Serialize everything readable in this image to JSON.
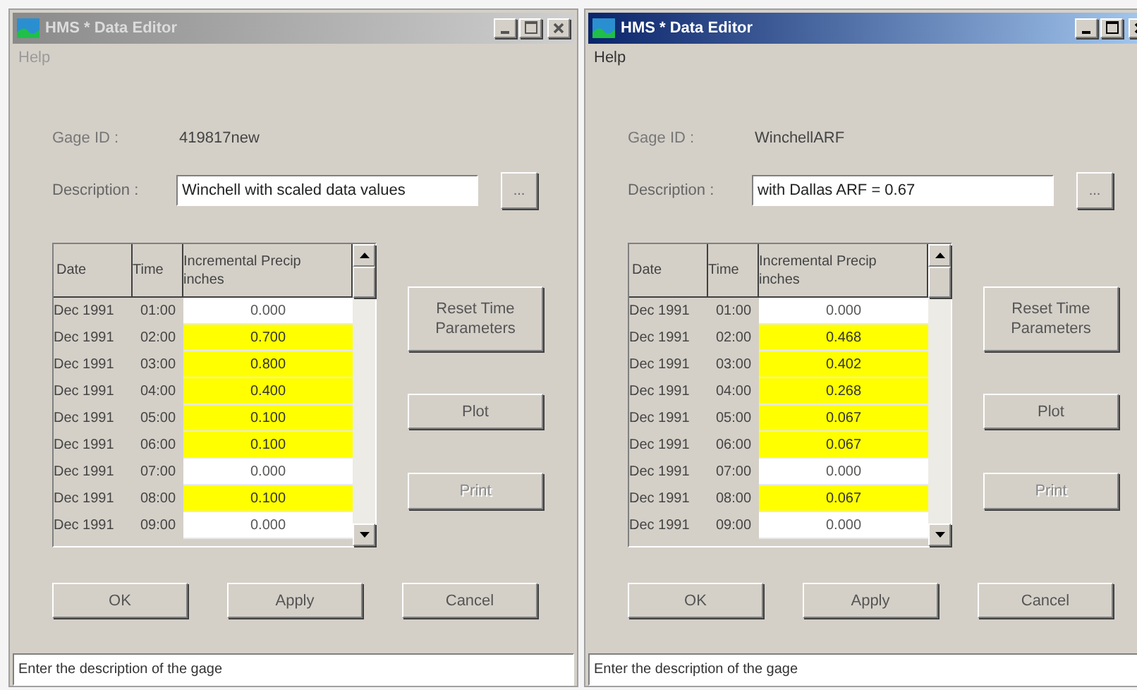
{
  "windows": [
    {
      "title": "HMS * Data Editor",
      "active": false,
      "menu": [
        "Help"
      ],
      "gage_id_label": "Gage ID :",
      "gage_id": "419817new",
      "description_label": "Description :",
      "description": "Winchell with scaled data values",
      "browse_button": "...",
      "table": {
        "columns": [
          {
            "label": "Date"
          },
          {
            "label": "Time"
          },
          {
            "label": "Incremental Precip",
            "unit": "inches"
          }
        ],
        "rows": [
          {
            "date": "Dec 1991",
            "time": "01:00",
            "value": "0.000",
            "modified": false
          },
          {
            "date": "Dec 1991",
            "time": "02:00",
            "value": "0.700",
            "modified": true
          },
          {
            "date": "Dec 1991",
            "time": "03:00",
            "value": "0.800",
            "modified": true
          },
          {
            "date": "Dec 1991",
            "time": "04:00",
            "value": "0.400",
            "modified": true
          },
          {
            "date": "Dec 1991",
            "time": "05:00",
            "value": "0.100",
            "modified": true
          },
          {
            "date": "Dec 1991",
            "time": "06:00",
            "value": "0.100",
            "modified": true
          },
          {
            "date": "Dec 1991",
            "time": "07:00",
            "value": "0.000",
            "modified": false
          },
          {
            "date": "Dec 1991",
            "time": "08:00",
            "value": "0.100",
            "modified": true
          },
          {
            "date": "Dec 1991",
            "time": "09:00",
            "value": "0.000",
            "modified": false
          }
        ]
      },
      "side_buttons": [
        {
          "label": "Reset Time Parameters",
          "disabled": false
        },
        {
          "label": "Plot",
          "disabled": false
        },
        {
          "label": "Print",
          "disabled": true
        }
      ],
      "buttons": [
        "OK",
        "Apply",
        "Cancel"
      ],
      "status": "Enter the description of the gage"
    },
    {
      "title": "HMS * Data Editor",
      "active": true,
      "menu": [
        "Help"
      ],
      "gage_id_label": "Gage ID :",
      "gage_id": "WinchellARF",
      "description_label": "Description :",
      "description": "with Dallas ARF = 0.67",
      "browse_button": "...",
      "table": {
        "columns": [
          {
            "label": "Date"
          },
          {
            "label": "Time"
          },
          {
            "label": "Incremental Precip",
            "unit": "inches"
          }
        ],
        "rows": [
          {
            "date": "Dec 1991",
            "time": "01:00",
            "value": "0.000",
            "modified": false
          },
          {
            "date": "Dec 1991",
            "time": "02:00",
            "value": "0.468",
            "modified": true
          },
          {
            "date": "Dec 1991",
            "time": "03:00",
            "value": "0.402",
            "modified": true
          },
          {
            "date": "Dec 1991",
            "time": "04:00",
            "value": "0.268",
            "modified": true
          },
          {
            "date": "Dec 1991",
            "time": "05:00",
            "value": "0.067",
            "modified": true
          },
          {
            "date": "Dec 1991",
            "time": "06:00",
            "value": "0.067",
            "modified": true
          },
          {
            "date": "Dec 1991",
            "time": "07:00",
            "value": "0.000",
            "modified": false
          },
          {
            "date": "Dec 1991",
            "time": "08:00",
            "value": "0.067",
            "modified": true
          },
          {
            "date": "Dec 1991",
            "time": "09:00",
            "value": "0.000",
            "modified": false
          }
        ]
      },
      "side_buttons": [
        {
          "label": "Reset Time Parameters",
          "disabled": false
        },
        {
          "label": "Plot",
          "disabled": false
        },
        {
          "label": "Print",
          "disabled": true
        }
      ],
      "buttons": [
        "OK",
        "Apply",
        "Cancel"
      ],
      "status": "Enter the description of the gage"
    }
  ]
}
